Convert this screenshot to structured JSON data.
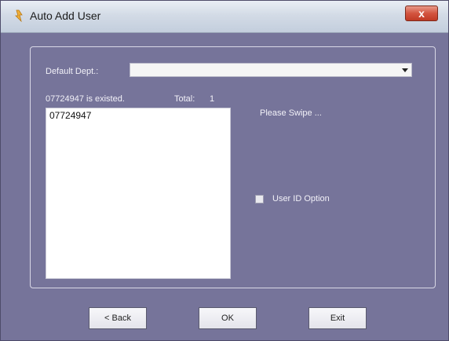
{
  "window": {
    "title": "Auto Add User",
    "close_label": "x"
  },
  "form": {
    "default_dept_label": "Default Dept.:",
    "default_dept_value": "",
    "status_text": "07724947 is existed.",
    "total_label": "Total:",
    "total_value": "1",
    "list_items": [
      "07724947"
    ],
    "swipe_prompt": "Please Swipe ...",
    "user_id_option_label": "User ID Option",
    "user_id_option_checked": false
  },
  "buttons": {
    "back": "< Back",
    "ok": "OK",
    "exit": "Exit"
  },
  "colors": {
    "background": "#76749a",
    "close_button": "#c03a24"
  }
}
